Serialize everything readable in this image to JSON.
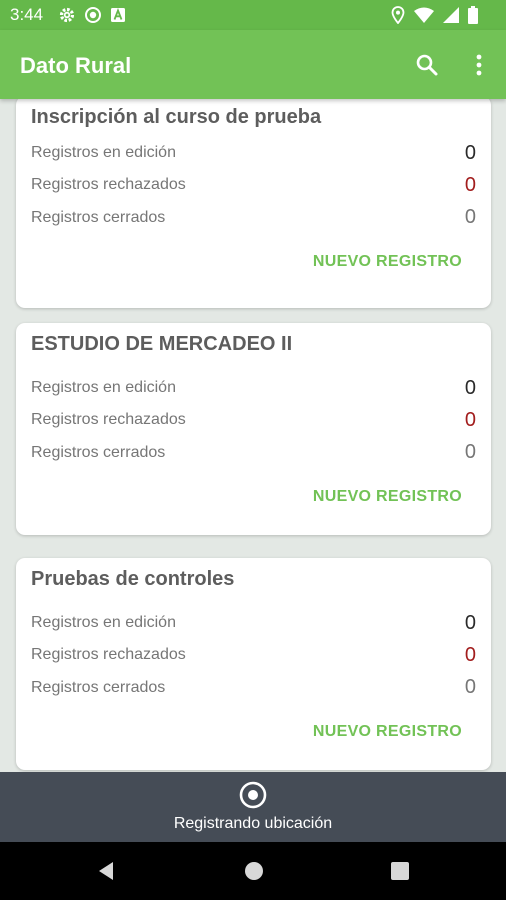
{
  "status_bar": {
    "time": "3:44",
    "left_icons": [
      "gear-icon",
      "media-icon",
      "a-badge-icon"
    ],
    "right_icons": [
      "location-pin-icon",
      "wifi-icon",
      "signal-icon",
      "battery-icon"
    ]
  },
  "app_bar": {
    "title": "Dato Rural",
    "actions": [
      "search-icon",
      "more-vert-icon"
    ],
    "color": "#72c256"
  },
  "cards": [
    {
      "title": "Inscripción al curso de prueba",
      "stats": [
        {
          "label": "Registros en edición",
          "value": "0"
        },
        {
          "label": "Registros rechazados",
          "value": "0"
        },
        {
          "label": "Registros cerrados",
          "value": "0"
        }
      ],
      "action": "NUEVO REGISTRO"
    },
    {
      "title": "ESTUDIO DE MERCADEO II",
      "stats": [
        {
          "label": "Registros en edición",
          "value": "0"
        },
        {
          "label": "Registros rechazados",
          "value": "0"
        },
        {
          "label": "Registros cerrados",
          "value": "0"
        }
      ],
      "action": "NUEVO REGISTRO"
    },
    {
      "title": "Pruebas de controles",
      "stats": [
        {
          "label": "Registros en edición",
          "value": "0"
        },
        {
          "label": "Registros rechazados",
          "value": "0"
        },
        {
          "label": "Registros cerrados",
          "value": "0"
        }
      ],
      "action": "NUEVO REGISTRO"
    }
  ],
  "location_bar": {
    "icon": "target-location-icon",
    "text": "Registrando ubicación"
  },
  "nav_bar": {
    "buttons": [
      "back-icon",
      "home-icon",
      "recents-icon"
    ]
  },
  "colors": {
    "accent": "#72c256",
    "rejected": "#a21d1d",
    "location_bar": "#454c56"
  }
}
